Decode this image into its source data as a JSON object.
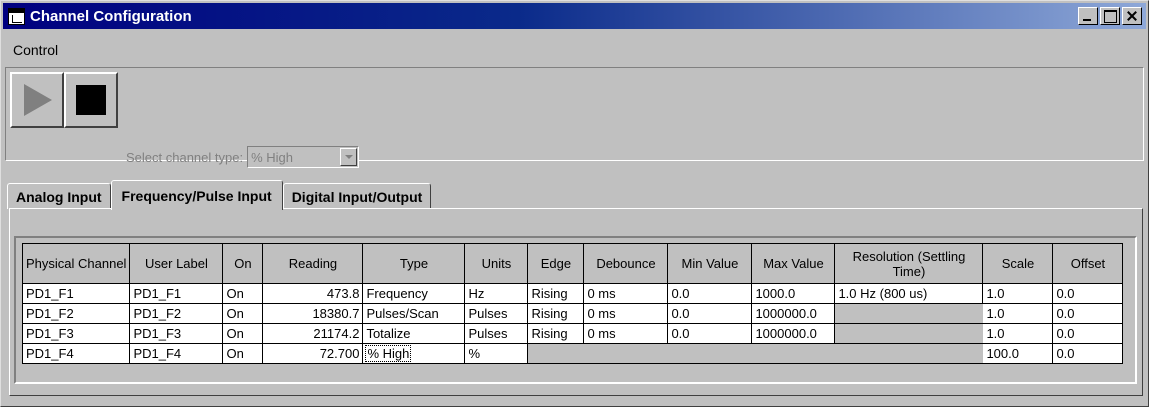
{
  "window": {
    "title": "Channel Configuration"
  },
  "menu": {
    "items": [
      "Control"
    ]
  },
  "toolbar": {
    "buttons": [
      "play-icon",
      "stop-icon"
    ]
  },
  "channel_type": {
    "label": "Select channel type:",
    "value": "% High"
  },
  "tabs": [
    {
      "label": "Analog Input",
      "active": false
    },
    {
      "label": "Frequency/Pulse Input",
      "active": true
    },
    {
      "label": "Digital Input/Output",
      "active": false
    }
  ],
  "table": {
    "headers": [
      "Physical Channel",
      "User Label",
      "On",
      "Reading",
      "Type",
      "Units",
      "Edge",
      "Debounce",
      "Min Value",
      "Max Value",
      "Resolution (Settling Time)",
      "Scale",
      "Offset"
    ],
    "rows": [
      [
        "PD1_F1",
        "PD1_F1",
        "On",
        "473.8",
        "Frequency",
        "Hz",
        "Rising",
        "0 ms",
        "0.0",
        "1000.0",
        "1.0 Hz (800 us)",
        "1.0",
        "0.0"
      ],
      [
        "PD1_F2",
        "PD1_F2",
        "On",
        "18380.7",
        "Pulses/Scan",
        "Pulses",
        "Rising",
        "0 ms",
        "0.0",
        "1000000.0",
        "",
        "1.0",
        "0.0"
      ],
      [
        "PD1_F3",
        "PD1_F3",
        "On",
        "21174.2",
        "Totalize",
        "Pulses",
        "Rising",
        "0 ms",
        "0.0",
        "1000000.0",
        "",
        "1.0",
        "0.0"
      ],
      [
        "PD1_F4",
        "PD1_F4",
        "On",
        "72.700",
        "% High",
        "%",
        "",
        "",
        "",
        "",
        "",
        "100.0",
        "0.0"
      ]
    ]
  }
}
